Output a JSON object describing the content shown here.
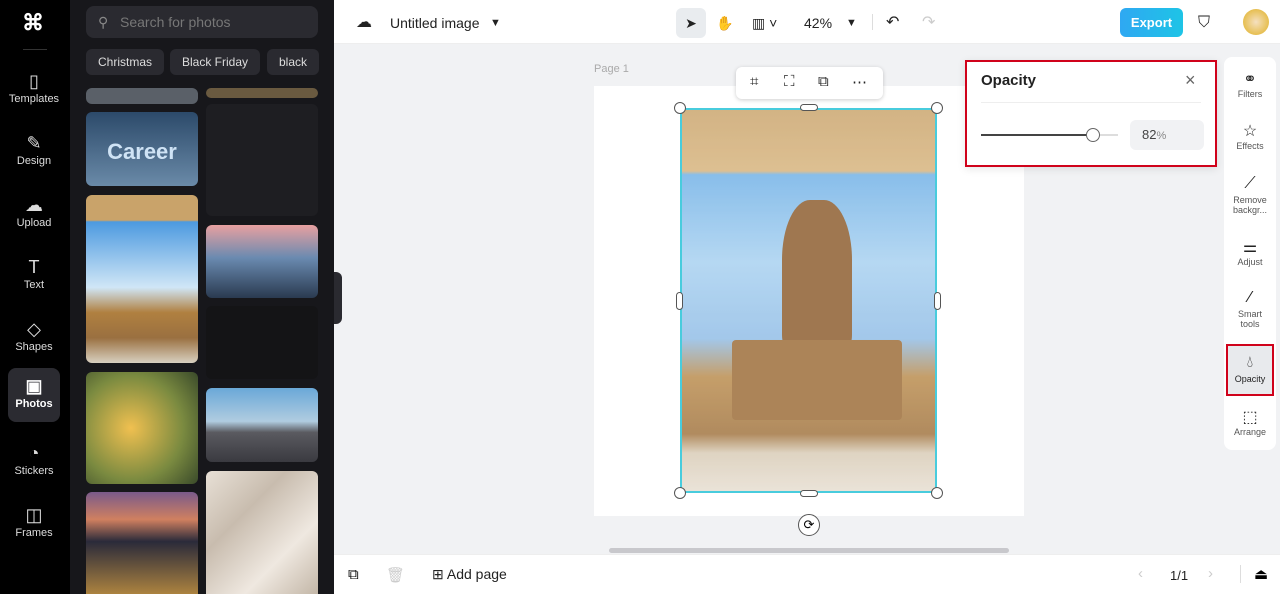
{
  "rail": {
    "items": [
      {
        "label": "Templates",
        "icon": "templates-icon"
      },
      {
        "label": "Design",
        "icon": "design-icon"
      },
      {
        "label": "Upload",
        "icon": "upload-icon"
      },
      {
        "label": "Text",
        "icon": "text-icon"
      },
      {
        "label": "Shapes",
        "icon": "shapes-icon"
      },
      {
        "label": "Photos",
        "icon": "photos-icon"
      },
      {
        "label": "Stickers",
        "icon": "stickers-icon"
      },
      {
        "label": "Frames",
        "icon": "frames-icon"
      }
    ]
  },
  "panel": {
    "search_placeholder": "Search for photos",
    "chips": [
      "Christmas",
      "Black Friday",
      "black"
    ],
    "photo_text": "Career"
  },
  "topbar": {
    "title": "Untitled image",
    "zoom": "42%",
    "export": "Export"
  },
  "canvas": {
    "page_label": "Page 1"
  },
  "opacity": {
    "title": "Opacity",
    "value": 82,
    "value_text": "82",
    "unit": "%"
  },
  "tools": [
    {
      "label": "Filters"
    },
    {
      "label": "Effects"
    },
    {
      "label": "Remove backgr..."
    },
    {
      "label": "Adjust"
    },
    {
      "label": "Smart tools"
    },
    {
      "label": "Opacity"
    },
    {
      "label": "Arrange"
    }
  ],
  "bottom": {
    "add_page": "Add page",
    "pages": "1/1"
  },
  "colors": {
    "accent": "#21c2d6",
    "highlight": "#d0021b"
  }
}
